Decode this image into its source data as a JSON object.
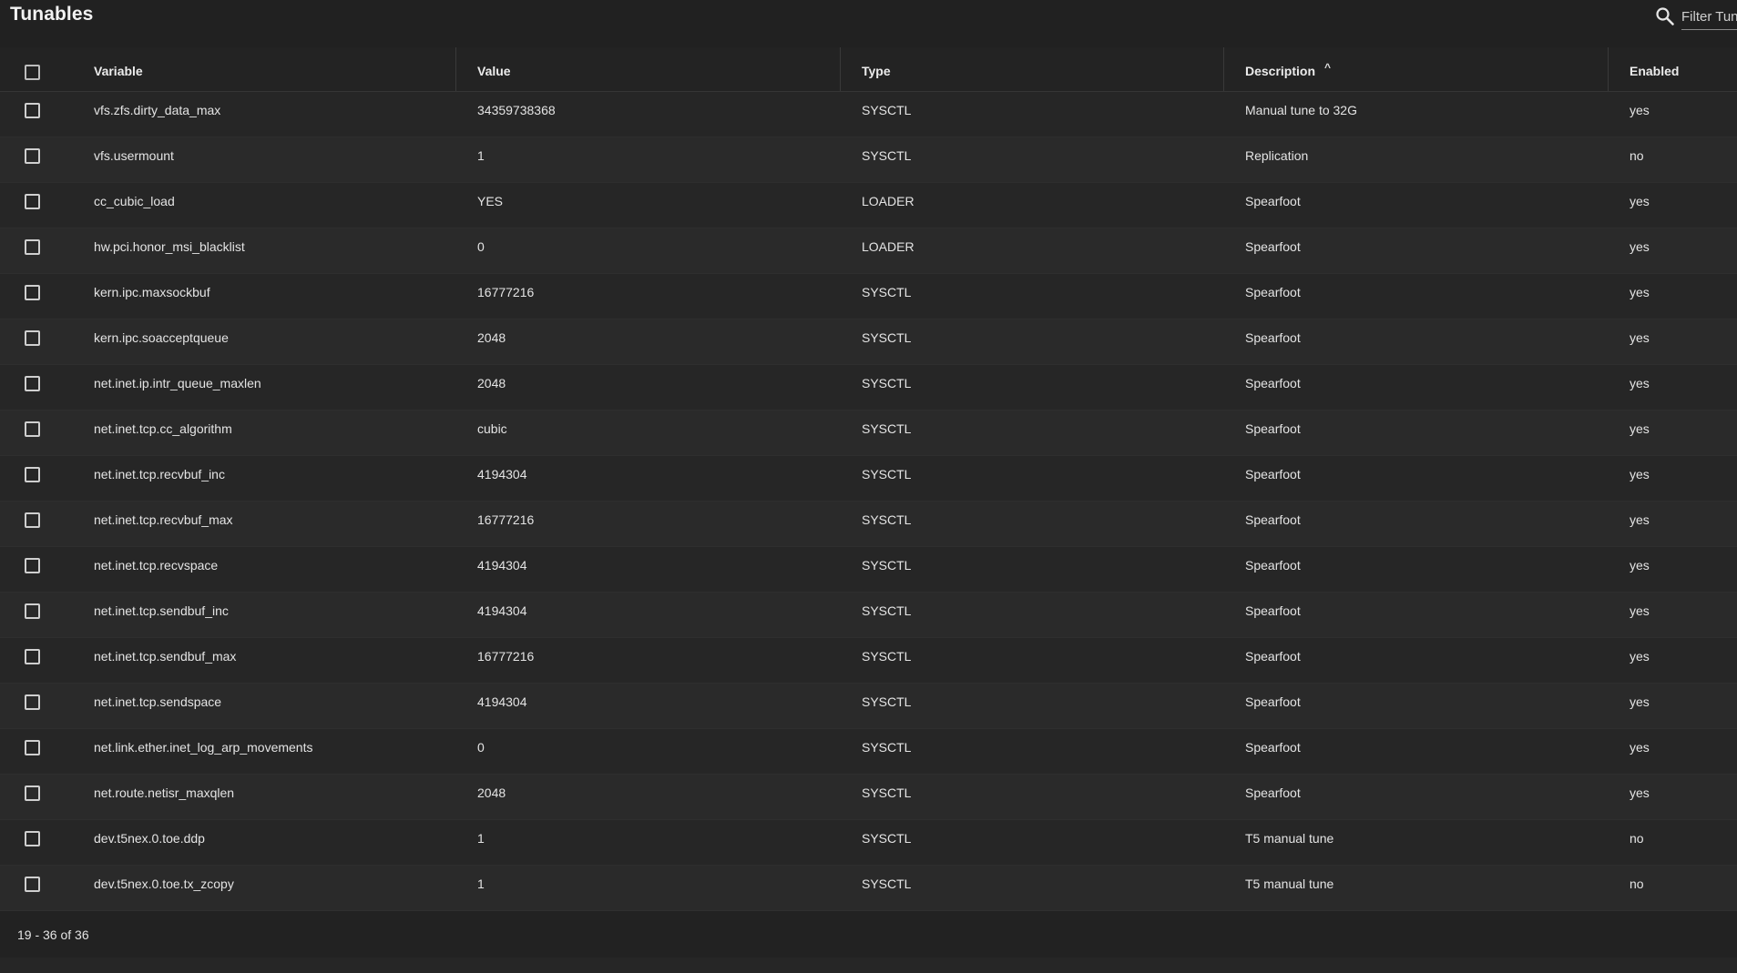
{
  "header": {
    "title": "Tunables",
    "filter_placeholder": "Filter Tunables"
  },
  "columns": {
    "variable": "Variable",
    "value": "Value",
    "type": "Type",
    "description": "Description",
    "enabled": "Enabled",
    "sort_indicator": "^"
  },
  "rows": [
    {
      "variable": "vfs.zfs.dirty_data_max",
      "value": "34359738368",
      "type": "SYSCTL",
      "description": "Manual tune to 32G",
      "enabled": "yes"
    },
    {
      "variable": "vfs.usermount",
      "value": "1",
      "type": "SYSCTL",
      "description": "Replication",
      "enabled": "no"
    },
    {
      "variable": "cc_cubic_load",
      "value": "YES",
      "type": "LOADER",
      "description": "Spearfoot",
      "enabled": "yes"
    },
    {
      "variable": "hw.pci.honor_msi_blacklist",
      "value": "0",
      "type": "LOADER",
      "description": "Spearfoot",
      "enabled": "yes"
    },
    {
      "variable": "kern.ipc.maxsockbuf",
      "value": "16777216",
      "type": "SYSCTL",
      "description": "Spearfoot",
      "enabled": "yes"
    },
    {
      "variable": "kern.ipc.soacceptqueue",
      "value": "2048",
      "type": "SYSCTL",
      "description": "Spearfoot",
      "enabled": "yes"
    },
    {
      "variable": "net.inet.ip.intr_queue_maxlen",
      "value": "2048",
      "type": "SYSCTL",
      "description": "Spearfoot",
      "enabled": "yes"
    },
    {
      "variable": "net.inet.tcp.cc_algorithm",
      "value": "cubic",
      "type": "SYSCTL",
      "description": "Spearfoot",
      "enabled": "yes"
    },
    {
      "variable": "net.inet.tcp.recvbuf_inc",
      "value": "4194304",
      "type": "SYSCTL",
      "description": "Spearfoot",
      "enabled": "yes"
    },
    {
      "variable": "net.inet.tcp.recvbuf_max",
      "value": "16777216",
      "type": "SYSCTL",
      "description": "Spearfoot",
      "enabled": "yes"
    },
    {
      "variable": "net.inet.tcp.recvspace",
      "value": "4194304",
      "type": "SYSCTL",
      "description": "Spearfoot",
      "enabled": "yes"
    },
    {
      "variable": "net.inet.tcp.sendbuf_inc",
      "value": "4194304",
      "type": "SYSCTL",
      "description": "Spearfoot",
      "enabled": "yes"
    },
    {
      "variable": "net.inet.tcp.sendbuf_max",
      "value": "16777216",
      "type": "SYSCTL",
      "description": "Spearfoot",
      "enabled": "yes"
    },
    {
      "variable": "net.inet.tcp.sendspace",
      "value": "4194304",
      "type": "SYSCTL",
      "description": "Spearfoot",
      "enabled": "yes"
    },
    {
      "variable": "net.link.ether.inet_log_arp_movements",
      "value": "0",
      "type": "SYSCTL",
      "description": "Spearfoot",
      "enabled": "yes"
    },
    {
      "variable": "net.route.netisr_maxqlen",
      "value": "2048",
      "type": "SYSCTL",
      "description": "Spearfoot",
      "enabled": "yes"
    },
    {
      "variable": "dev.t5nex.0.toe.ddp",
      "value": "1",
      "type": "SYSCTL",
      "description": "T5 manual tune",
      "enabled": "no"
    },
    {
      "variable": "dev.t5nex.0.toe.tx_zcopy",
      "value": "1",
      "type": "SYSCTL",
      "description": "T5 manual tune",
      "enabled": "no"
    }
  ],
  "footer": {
    "range_label": "19 - 36 of 36"
  }
}
